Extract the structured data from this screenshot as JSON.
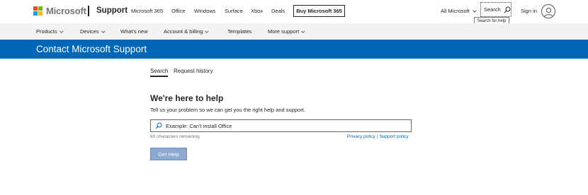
{
  "header": {
    "brand": "Microsoft",
    "section": "Support",
    "nav": [
      "Microsoft 365",
      "Office",
      "Windows",
      "Surface",
      "Xbox",
      "Deals"
    ],
    "buy_button": "Buy Microsoft 365",
    "all_microsoft": "All Microsoft",
    "search_label": "Search",
    "search_tooltip": "Search for help",
    "sign_in": "Sign in"
  },
  "subnav": {
    "items": [
      {
        "label": "Products",
        "has_dropdown": true
      },
      {
        "label": "Devices",
        "has_dropdown": true
      },
      {
        "label": "What's new",
        "has_dropdown": false
      },
      {
        "label": "Account & billing",
        "has_dropdown": true
      },
      {
        "label": "Templates",
        "has_dropdown": false
      },
      {
        "label": "More support",
        "has_dropdown": true
      }
    ]
  },
  "banner": {
    "title": "Contact Microsoft Support",
    "color": "#0067b8"
  },
  "main": {
    "tabs": [
      {
        "label": "Search",
        "active": true
      },
      {
        "label": "Request history",
        "active": false
      }
    ],
    "heading": "We're here to help",
    "subtext": "Tell us your problem so we can get you the right help and support.",
    "input": {
      "placeholder": "Example: Can't install Office",
      "value": ""
    },
    "remaining": "80 characters remaining",
    "privacy_policy": "Privacy policy",
    "policy_separator": "|",
    "support_policy": "Support policy",
    "submit_label": "Get Help"
  },
  "icons": {
    "logo": "microsoft-logo-icon",
    "search": "search-icon",
    "avatar": "user-avatar-icon",
    "chevron": "chevron-down-icon"
  }
}
